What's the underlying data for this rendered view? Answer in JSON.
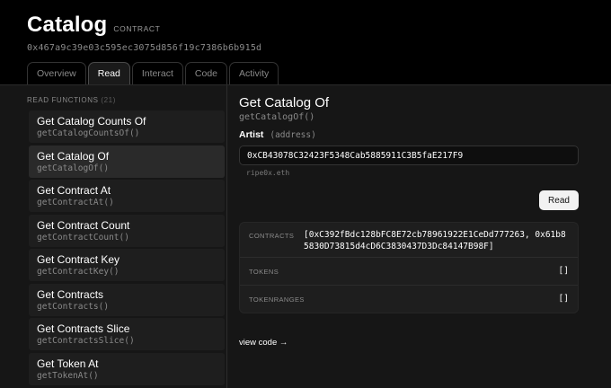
{
  "header": {
    "title": "Catalog",
    "badge": "CONTRACT",
    "address": "0x467a9c39e03c595ec3075d856f19c7386b6b915d"
  },
  "tabs": [
    "Overview",
    "Read",
    "Interact",
    "Code",
    "Activity"
  ],
  "active_tab": "Read",
  "sidebar": {
    "title": "READ FUNCTIONS",
    "count": "(21)",
    "items": [
      {
        "name": "Get Catalog Counts Of",
        "sig": "getCatalogCountsOf()"
      },
      {
        "name": "Get Catalog Of",
        "sig": "getCatalogOf()"
      },
      {
        "name": "Get Contract At",
        "sig": "getContractAt()"
      },
      {
        "name": "Get Contract Count",
        "sig": "getContractCount()"
      },
      {
        "name": "Get Contract Key",
        "sig": "getContractKey()"
      },
      {
        "name": "Get Contracts",
        "sig": "getContracts()"
      },
      {
        "name": "Get Contracts Slice",
        "sig": "getContractsSlice()"
      },
      {
        "name": "Get Token At",
        "sig": "getTokenAt()"
      }
    ]
  },
  "main": {
    "title": "Get Catalog Of",
    "sig": "getCatalogOf()",
    "arg_label": "Artist",
    "arg_type": "(address)",
    "arg_value": "0xCB43078C32423F5348Cab5885911C3B5faE217F9",
    "ens_hint": "ripe0x.eth",
    "read_button": "Read",
    "results": [
      {
        "key": "CONTRACTS",
        "value": "[0xC392fBdc128bFC8E72cb78961922E1CeDd777263, 0x61b85830D73815d4cD6C3830437D3Dc84147B98F]"
      },
      {
        "key": "TOKENS",
        "value": "[]"
      },
      {
        "key": "TOKENRANGES",
        "value": "[]"
      }
    ],
    "view_code": "view code →"
  }
}
